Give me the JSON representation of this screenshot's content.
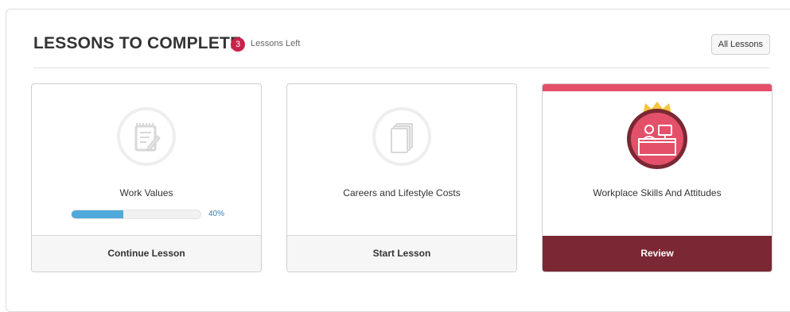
{
  "header": {
    "title": "LESSONS TO COMPLETE",
    "badge_count": "3",
    "badge_label": "Lessons Left",
    "all_lessons_label": "All Lessons"
  },
  "cards": [
    {
      "title": "Work Values",
      "icon": "notepad-icon",
      "progress_percent": 40,
      "progress_label": "40%",
      "action_label": "Continue Lesson"
    },
    {
      "title": "Careers and Lifestyle Costs",
      "icon": "stack-pages-icon",
      "action_label": "Start Lesson"
    },
    {
      "title": "Workplace Skills And Attitudes",
      "icon": "receptionist-desk-icon",
      "action_label": "Review",
      "accent_color": "#e4506a",
      "action_color": "#7a2834",
      "crown_color": "#f5c542"
    }
  ]
}
